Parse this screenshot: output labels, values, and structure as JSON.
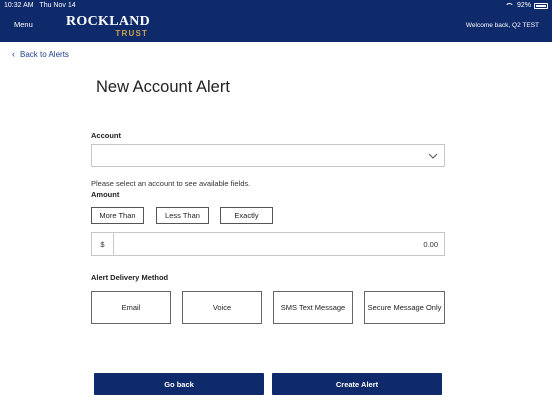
{
  "status_bar": {
    "time": "10:32 AM",
    "date": "Thu Nov 14",
    "battery": "92%",
    "wifi_icon": "wifi-icon",
    "battery_icon": "battery-icon"
  },
  "navbar": {
    "menu_label": "Menu",
    "logo_top": "ROCKLAND",
    "logo_bottom": "TRUST",
    "welcome": "Welcome back, Q2 TEST",
    "background_color": "#0f2a6b",
    "logo_accent_color": "#c9a24a"
  },
  "back_link": {
    "label": "Back to Alerts",
    "icon": "chevron-left-icon"
  },
  "title": "New Account Alert",
  "account": {
    "label": "Account",
    "selected_value": "",
    "hint": "Please select an account to see available fields.",
    "icon": "chevron-down-icon"
  },
  "amount": {
    "label": "Amount",
    "comparators": [
      "More Than",
      "Less Than",
      "Exactly"
    ],
    "currency_symbol": "$",
    "placeholder": "0.00"
  },
  "delivery": {
    "label": "Alert Delivery Method",
    "methods": [
      "Email",
      "Voice",
      "SMS Text Message",
      "Secure Message Only"
    ]
  },
  "actions": {
    "go_back": "Go back",
    "create": "Create Alert",
    "button_color": "#0f2a6b"
  }
}
